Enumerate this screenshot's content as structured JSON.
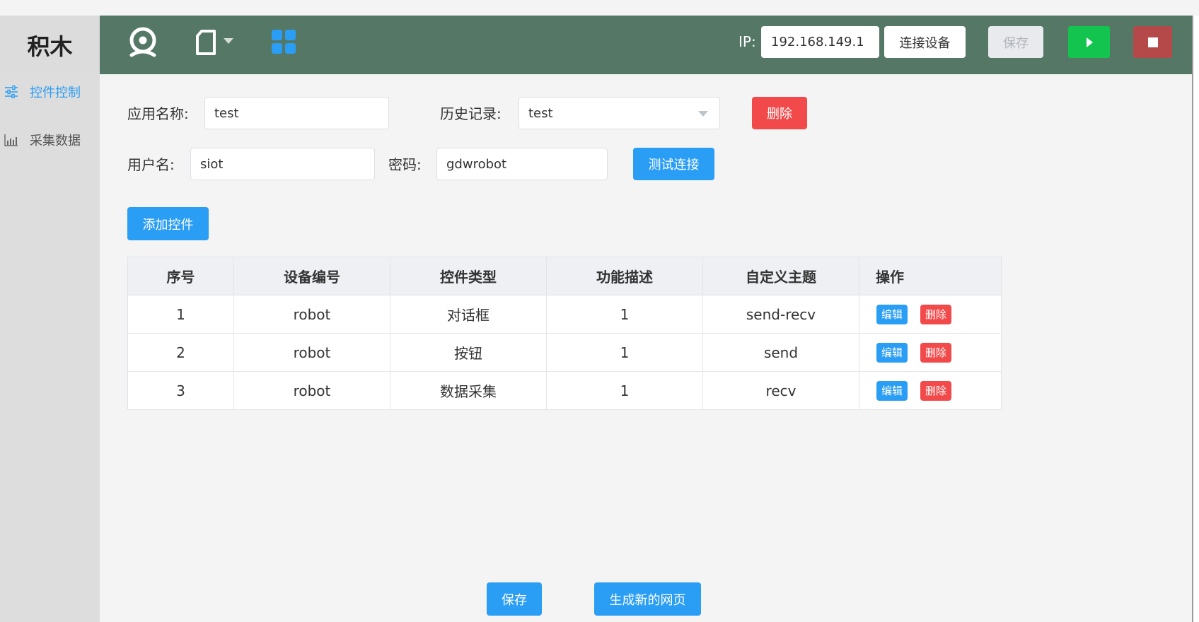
{
  "brand": "积木",
  "sidebar": {
    "items": [
      {
        "label": "控件控制",
        "icon": "sliders-icon",
        "active": true
      },
      {
        "label": "采集数据",
        "icon": "chart-icon",
        "active": false
      }
    ]
  },
  "header": {
    "icons": [
      "webcam-icon",
      "file-icon",
      "grid-icon"
    ],
    "ip_label": "IP:",
    "ip_value": "192.168.149.1",
    "connect_label": "连接设备",
    "save_label": "保存",
    "colors": {
      "bar": "#547766",
      "play": "#13c44f",
      "stop": "#b54949"
    }
  },
  "form": {
    "app_name_label": "应用名称:",
    "app_name_value": "test",
    "history_label": "历史记录:",
    "history_value": "test",
    "delete_label": "删除",
    "username_label": "用户名:",
    "username_value": "siot",
    "password_label": "密码:",
    "password_value": "gdwrobot",
    "test_label": "测试连接",
    "add_control_label": "添加控件"
  },
  "table": {
    "headers": [
      "序号",
      "设备编号",
      "控件类型",
      "功能描述",
      "自定义主题",
      "操作"
    ],
    "rows": [
      {
        "index": "1",
        "device": "robot",
        "type": "对话框",
        "desc": "1",
        "topic": "send-recv"
      },
      {
        "index": "2",
        "device": "robot",
        "type": "按钮",
        "desc": "1",
        "topic": "send"
      },
      {
        "index": "3",
        "device": "robot",
        "type": "数据采集",
        "desc": "1",
        "topic": "recv"
      }
    ],
    "edit_label": "编辑",
    "delete_label": "删除"
  },
  "footer": {
    "save_label": "保存",
    "generate_label": "生成新的网页"
  }
}
